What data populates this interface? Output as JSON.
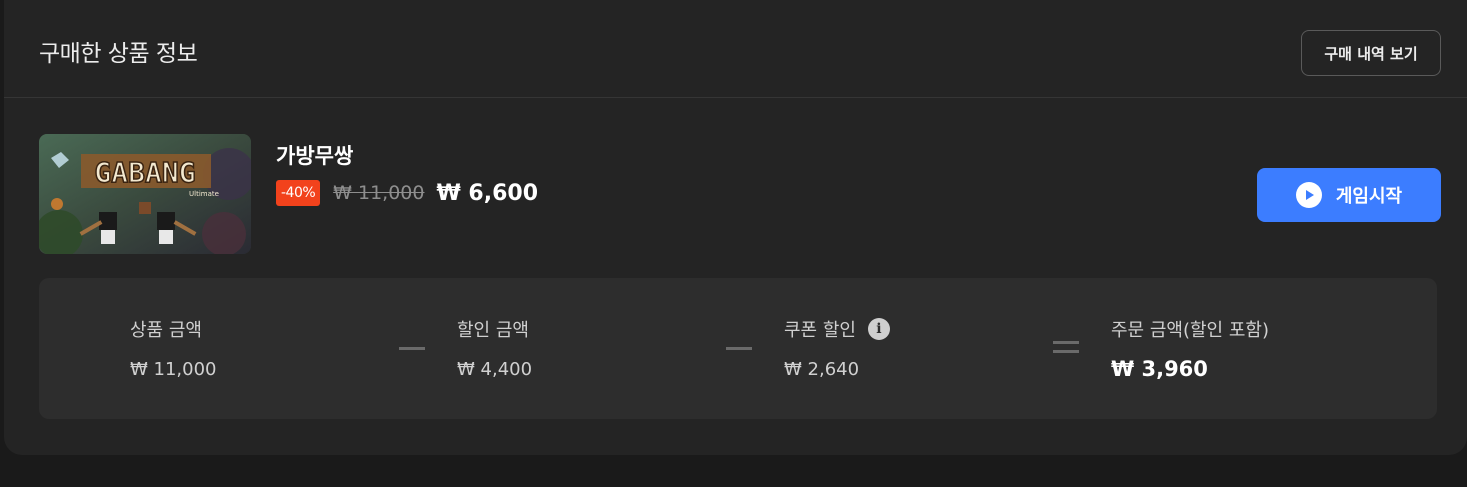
{
  "header": {
    "title": "구매한 상품 정보",
    "history_button": "구매 내역 보기"
  },
  "product": {
    "name": "가방무쌍",
    "thumbnail_logo": "GABANG",
    "thumbnail_sub": "Ultimate",
    "discount_badge": "-40%",
    "original_price": "₩ 11,000",
    "final_price": "₩ 6,600",
    "play_button": "게임시작",
    "play_icon": "play-circle-icon"
  },
  "summary": {
    "items": [
      {
        "label": "상품 금액",
        "value": "₩ 11,000"
      },
      {
        "label": "할인 금액",
        "value": "₩ 4,400"
      },
      {
        "label": "쿠폰 할인",
        "value": "₩ 2,640"
      },
      {
        "label": "주문 금액(할인 포함)",
        "value": "₩ 3,960"
      }
    ],
    "info_icon": "i"
  },
  "colors": {
    "background": "#1a1a1a",
    "card": "#242424",
    "summary_box": "#2d2d2d",
    "accent": "#3c7dff",
    "discount": "#f2421c"
  }
}
